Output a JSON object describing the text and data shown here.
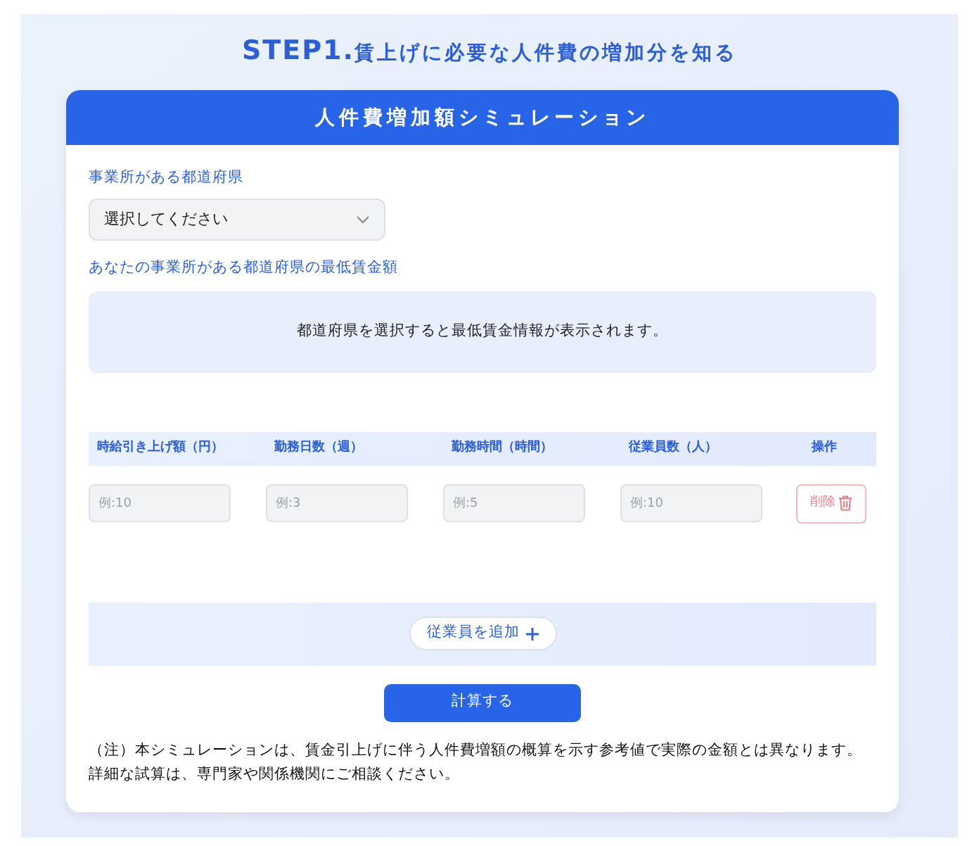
{
  "heading": {
    "step": "STEP1.",
    "text": "賃上げに必要な人件費の増加分を知る"
  },
  "card_title": "人件費増加額シミュレーション",
  "prefecture": {
    "label": "事業所がある都道府県",
    "placeholder": "選択してください"
  },
  "minimum_wage": {
    "label": "あなたの事業所がある都道府県の最低賃金額",
    "message": "都道府県を選択すると最低賃金情報が表示されます。"
  },
  "table": {
    "columns": [
      "時給引き上げ額（円）",
      "勤務日数（週）",
      "勤務時間（時間）",
      "従業員数（人）",
      "操作"
    ],
    "rows": [
      {
        "placeholders": [
          "例:10",
          "例:3",
          "例:5",
          "例:10"
        ],
        "delete_label": "削除"
      }
    ]
  },
  "add_button": "従業員を追加",
  "calculate_button": "計算する",
  "note": "（注）本シミュレーションは、賃金引上げに伴う人件費増額の概算を示す参考値で実際の金額とは異なります。詳細な試算は、専門家や関係機関にご相談ください。"
}
